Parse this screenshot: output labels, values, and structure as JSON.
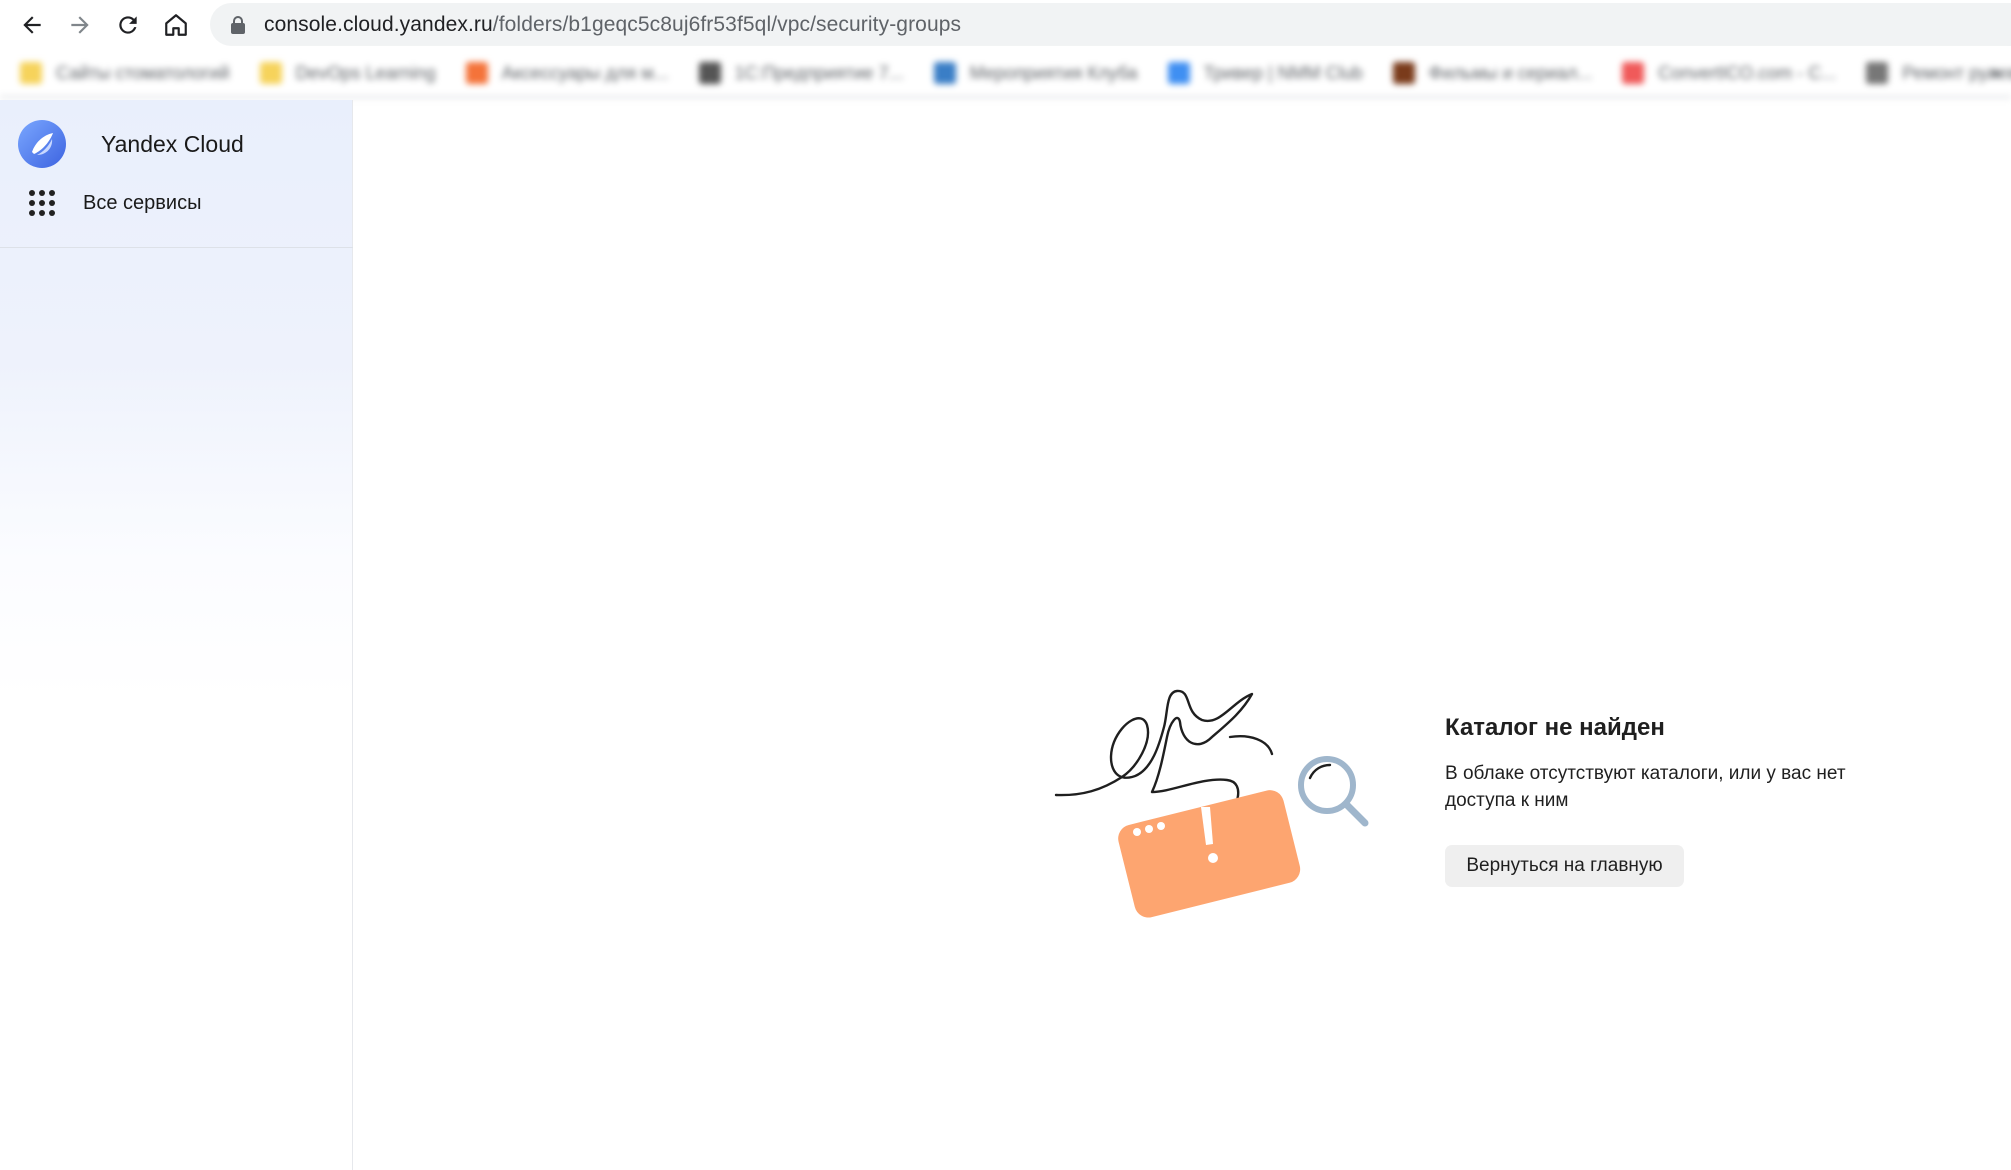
{
  "browser": {
    "url_host": "console.cloud.yandex.ru",
    "url_path": "/folders/b1geqc5c8uj6fr53f5ql/vpc/security-groups",
    "bookmarks": [
      {
        "label": "Сайты стоматологий",
        "icon": "folder-icon",
        "color": "#f6d35b"
      },
      {
        "label": "DevOps Learning",
        "icon": "folder-icon",
        "color": "#f6d35b"
      },
      {
        "label": "Аксессуары для м...",
        "icon": "site-icon",
        "color": "#f4733a"
      },
      {
        "label": "1С:Предприятие 7...",
        "icon": "site-icon",
        "color": "#555555"
      },
      {
        "label": "Мероприятия Клуба",
        "icon": "site-icon",
        "color": "#3a7ec6"
      },
      {
        "label": "Тривер | NMM Club",
        "icon": "site-icon",
        "color": "#3f8ff2"
      },
      {
        "label": "Фильмы и сериал...",
        "icon": "site-icon",
        "color": "#7a3b1b"
      },
      {
        "label": "ConvertICO.com - C...",
        "icon": "site-icon",
        "color": "#f05a5a"
      },
      {
        "label": "Ремонт рулевой р...",
        "icon": "site-icon",
        "color": "#777777"
      }
    ],
    "more": "»"
  },
  "sidebar": {
    "brand_name": "Yandex Cloud",
    "services_label": "Все сервисы"
  },
  "empty_state": {
    "title": "Каталог не найден",
    "description": "В облаке отсутствуют каталоги, или у вас нет доступа к ним",
    "button_label": "Вернуться на главную"
  },
  "colors": {
    "card": "#fda570",
    "magnifier": "#9fb6cc",
    "brand_blue": "#5b8cf0"
  }
}
